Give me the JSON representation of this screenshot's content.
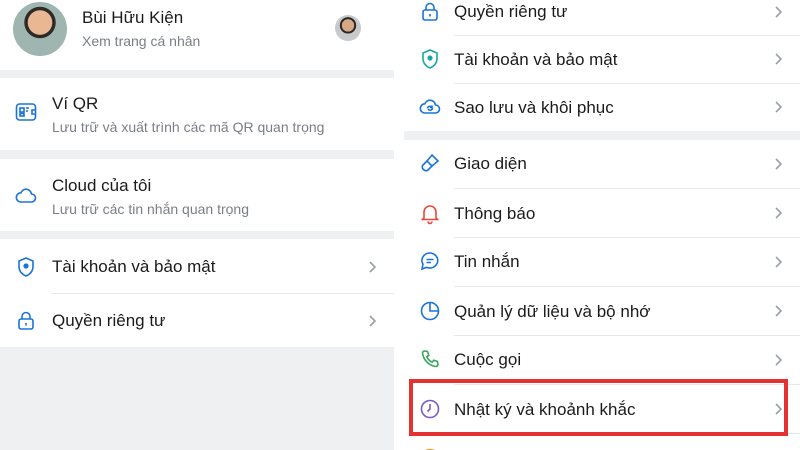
{
  "profile": {
    "name": "Bùi Hữu Kiện",
    "subtitle": "Xem trang cá nhân"
  },
  "left_menu": {
    "qr_wallet": {
      "title": "Ví QR",
      "subtitle": "Lưu trữ và xuất trình các mã QR quan trọng",
      "icon": "qr-wallet-icon"
    },
    "my_cloud": {
      "title": "Cloud của tôi",
      "subtitle": "Lưu trữ các tin nhắn quan trọng",
      "icon": "cloud-icon"
    },
    "account_security": {
      "label": "Tài khoản và bảo mật",
      "icon": "shield-icon"
    },
    "privacy": {
      "label": "Quyền riêng tư",
      "icon": "lock-icon"
    }
  },
  "right_menu": {
    "items": [
      {
        "label": "Quyền riêng tư",
        "icon": "lock-icon"
      },
      {
        "label": "Tài khoản và bảo mật",
        "icon": "shield-icon"
      },
      {
        "label": "Sao lưu và khôi phục",
        "icon": "cloud-sync-icon"
      },
      {
        "label": "Giao diện",
        "icon": "paintbrush-icon"
      },
      {
        "label": "Thông báo",
        "icon": "bell-icon"
      },
      {
        "label": "Tin nhắn",
        "icon": "chat-icon"
      },
      {
        "label": "Quản lý dữ liệu và bộ nhớ",
        "icon": "pie-chart-icon"
      },
      {
        "label": "Cuộc gọi",
        "icon": "phone-icon"
      },
      {
        "label": "Nhật ký và khoảnh khắc",
        "icon": "clock-icon"
      }
    ]
  },
  "colors": {
    "accent_blue": "#1a73d9",
    "bell_red": "#e64a3c",
    "phone_green": "#3aa55c",
    "clock_purple": "#7b5cc7",
    "highlight_red": "#e3322f",
    "background_gray": "#eef0f2"
  }
}
